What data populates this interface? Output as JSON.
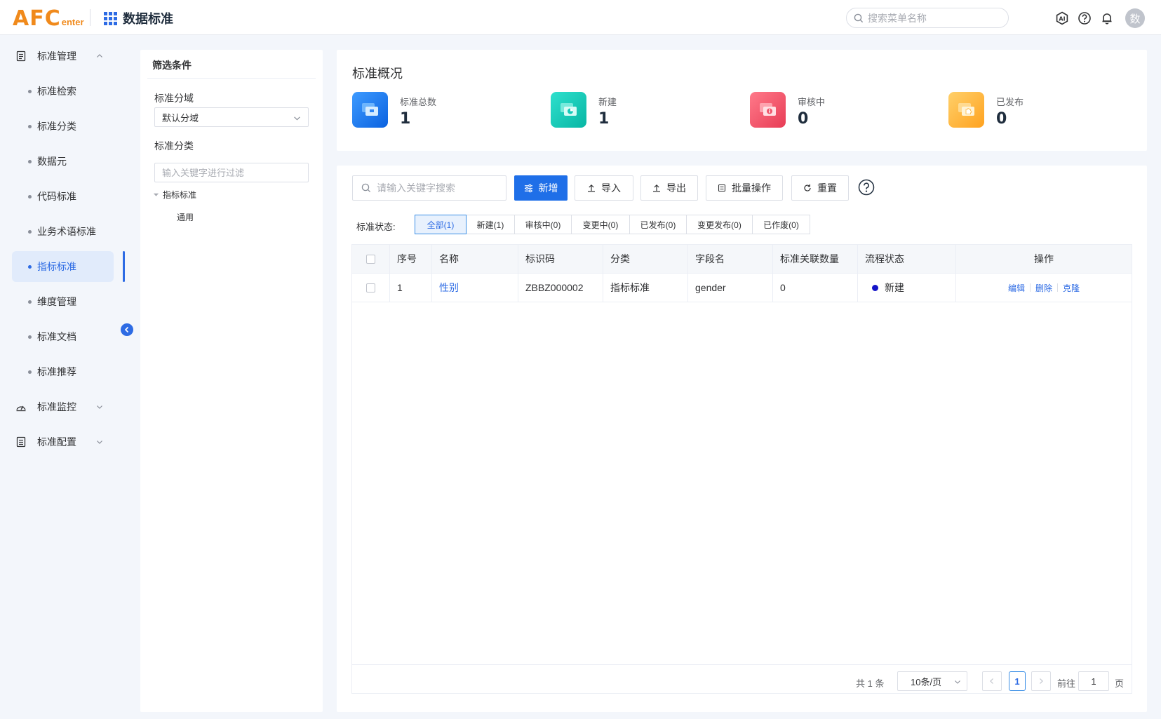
{
  "header": {
    "logo_main": "AFC",
    "logo_sub": "enter",
    "app_title": "数据标准",
    "menu_search_placeholder": "搜索菜单名称",
    "avatar_text": "数"
  },
  "nav": {
    "group1": "标准管理",
    "items": [
      "标准检索",
      "标准分类",
      "数据元",
      "代码标准",
      "业务术语标准",
      "指标标准",
      "维度管理",
      "标准文档",
      "标准推荐"
    ],
    "active_index": 5,
    "group2": "标准监控",
    "group3": "标准配置"
  },
  "filter": {
    "title": "筛选条件",
    "domain_label": "标准分域",
    "domain_value": "默认分域",
    "category_label": "标准分类",
    "category_placeholder": "输入关键字进行过滤",
    "tree_root": "指标标准",
    "tree_child": "通用"
  },
  "overview": {
    "heading": "标准概况",
    "stats": [
      {
        "label": "标准总数",
        "value": "1",
        "color": "#1e7bf0"
      },
      {
        "label": "新建",
        "value": "1",
        "color": "#14c9b8"
      },
      {
        "label": "审核中",
        "value": "0",
        "color": "#f0566b"
      },
      {
        "label": "已发布",
        "value": "0",
        "color": "#ffb73a"
      }
    ]
  },
  "toolbar": {
    "search_placeholder": "请输入关键字搜索",
    "add": "新增",
    "import": "导入",
    "export": "导出",
    "batch": "批量操作",
    "reset": "重置"
  },
  "status": {
    "label": "标准状态:",
    "tabs": [
      "全部(1)",
      "新建(1)",
      "审核中(0)",
      "变更中(0)",
      "已发布(0)",
      "变更发布(0)",
      "已作废(0)"
    ],
    "active_index": 0
  },
  "table": {
    "columns": [
      "序号",
      "名称",
      "标识码",
      "分类",
      "字段名",
      "标准关联数量",
      "流程状态",
      "操作"
    ],
    "rows": [
      {
        "index": "1",
        "name": "性别",
        "code": "ZBBZ000002",
        "category": "指标标准",
        "field": "gender",
        "count": "0",
        "state": "新建"
      }
    ],
    "actions": [
      "编辑",
      "删除",
      "克隆"
    ]
  },
  "pager": {
    "total": "共 1 条",
    "page_size": "10条/页",
    "current": "1",
    "goto_label": "前往",
    "goto_value": "1",
    "page_suffix": "页"
  },
  "colors": {
    "primary": "#1f6fe8",
    "link": "#2d6be4",
    "logo": "#f08a1c"
  }
}
